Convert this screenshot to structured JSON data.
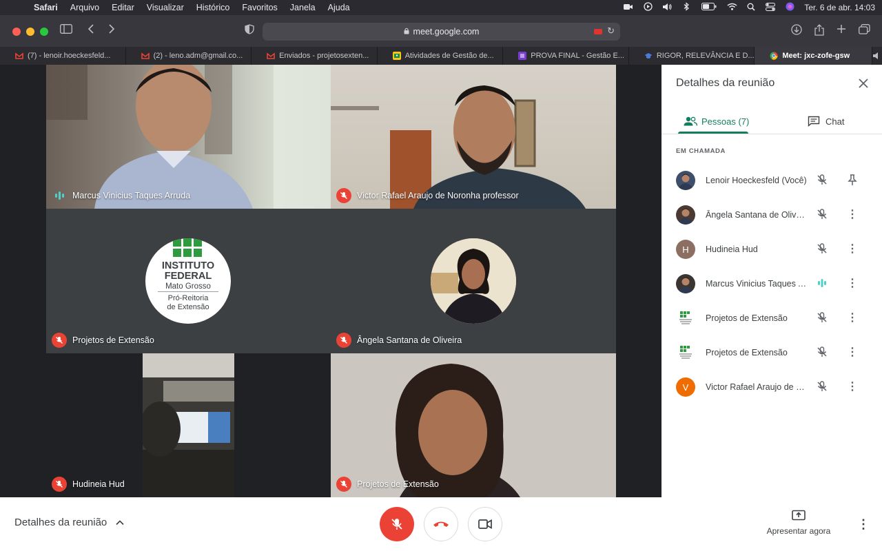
{
  "menubar": {
    "apple_icon": "apple-icon",
    "items": [
      "Safari",
      "Arquivo",
      "Editar",
      "Visualizar",
      "Histórico",
      "Favoritos",
      "Janela",
      "Ajuda"
    ],
    "datetime": "Ter. 6 de abr.  14:03"
  },
  "toolbar": {
    "url": "meet.google.com"
  },
  "tabs": [
    {
      "label": "(7) - lenoir.hoeckesfeld...",
      "favicon_color": "#ea4335"
    },
    {
      "label": "(2) - leno.adm@gmail.co...",
      "favicon_color": "#ea4335"
    },
    {
      "label": "Enviados - projetosexten...",
      "favicon_color": "#ea4335"
    },
    {
      "label": "Atividades de Gestão de...",
      "favicon_color": "#f5c518"
    },
    {
      "label": "PROVA FINAL - Gestão E...",
      "favicon_color": "#7a3ccf"
    },
    {
      "label": "RIGOR, RELEVÂNCIA E D...",
      "favicon_color": "#4a7bd8"
    },
    {
      "label": "Meet: jxc-zofe-gsw",
      "favicon_color": "#34a853"
    }
  ],
  "tiles": [
    {
      "name": "Marcus Vinicius Taques Arruda",
      "status": "speaking"
    },
    {
      "name": "Victor Rafael Araujo de Noronha professor",
      "status": "muted"
    },
    {
      "name": "Projetos de Extensão",
      "status": "muted"
    },
    {
      "name": "Ângela Santana de Oliveira",
      "status": "muted"
    },
    {
      "name": "Hudineia Hud",
      "status": "muted"
    },
    {
      "name": "Projetos de Extensão",
      "status": "muted"
    }
  ],
  "logo": {
    "line1": "INSTITUTO",
    "line2": "FEDERAL",
    "line3": "Mato Grosso",
    "line4": "Pró-Reitoria",
    "line5": "de Extensão"
  },
  "panel": {
    "title": "Detalhes da reunião",
    "tab_people": "Pessoas (7)",
    "tab_chat": "Chat",
    "section": "EM CHAMADA",
    "people": [
      {
        "name": "Lenoir Hoeckesfeld (Você)",
        "avatar": "photo",
        "action": "pin-icon"
      },
      {
        "name": "Ângela Santana de Olivei...",
        "avatar": "photo",
        "action": "more-icon"
      },
      {
        "name": "Hudineia Hud",
        "avatar": "letter",
        "initial": "H",
        "color": "#8d6e63",
        "action": "more-icon"
      },
      {
        "name": "Marcus Vinicius Taques A...",
        "avatar": "photo",
        "action": "more-icon"
      },
      {
        "name": "Projetos de Extensão",
        "avatar": "logo",
        "action": "more-icon"
      },
      {
        "name": "Projetos de Extensão",
        "avatar": "logo",
        "action": "more-icon"
      },
      {
        "name": "Victor Rafael Araujo de N...",
        "avatar": "letter",
        "initial": "V",
        "color": "#ef6c00",
        "action": "more-icon"
      }
    ]
  },
  "bottom": {
    "details_label": "Detalhes da reunião",
    "present_label": "Apresentar agora"
  }
}
